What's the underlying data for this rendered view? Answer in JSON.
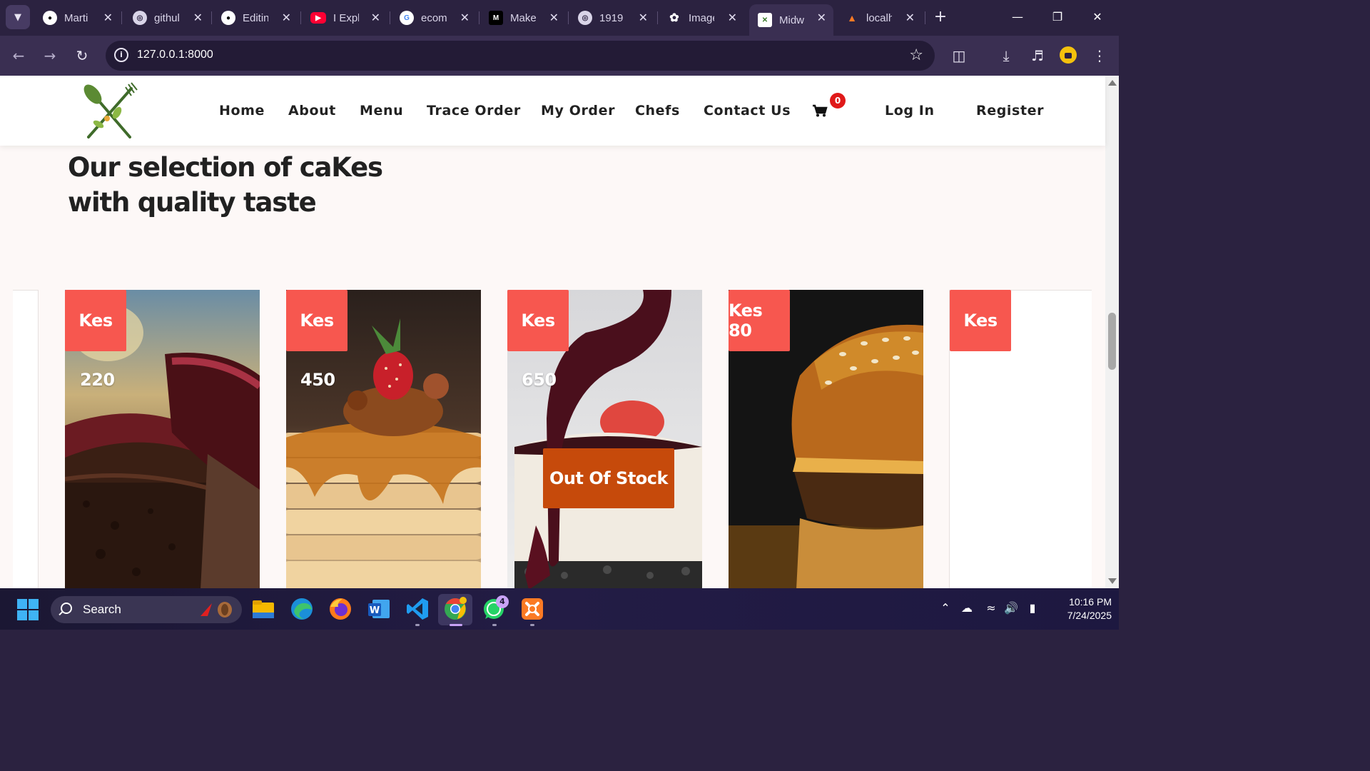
{
  "browser": {
    "tabs": [
      {
        "title": "Marti",
        "icon": "github-icon"
      },
      {
        "title": "githul",
        "icon": "globe-icon"
      },
      {
        "title": "Editin",
        "icon": "github-icon"
      },
      {
        "title": "I Expl",
        "icon": "youtube-icon"
      },
      {
        "title": "ecom",
        "icon": "google-icon"
      },
      {
        "title": "Make",
        "icon": "medium-icon",
        "favicon_text": "M"
      },
      {
        "title": "1919",
        "icon": "globe-icon"
      },
      {
        "title": "Image",
        "icon": "openai-icon"
      },
      {
        "title": "Midw",
        "icon": "site-icon",
        "active": true
      },
      {
        "title": "localh",
        "icon": "xampp-icon"
      }
    ],
    "url": "127.0.0.1:8000"
  },
  "site": {
    "nav": {
      "links": [
        "Home",
        "About",
        "Menu",
        "Trace Order",
        "My Order",
        "Chefs",
        "Contact Us"
      ],
      "cart_count": "0",
      "login": "Log In",
      "register": "Register"
    },
    "section_title_line1": "Our selection of caKes",
    "section_title_line2": "with quality taste",
    "products": [
      {
        "price_tag": "Kes",
        "price_value": "220",
        "image": "chocolate cake"
      },
      {
        "price_tag": "Kes",
        "price_value": "450",
        "image": "pancakes"
      },
      {
        "price_tag": "Kes",
        "price_value": "650",
        "image": "cheesecake",
        "badge": "Out Of Stock"
      },
      {
        "price_tag": "Kes 80",
        "price_value": "",
        "image": "burger"
      },
      {
        "price_tag": "Kes",
        "price_value": "",
        "image": "blank"
      }
    ]
  },
  "taskbar": {
    "search_label": "Search",
    "whatsapp_badge": "4",
    "time": "10:16 PM",
    "date": "7/24/2025"
  },
  "colors": {
    "price_tag": "#f7574f",
    "out_of_stock": "#c64a0b",
    "cart_badge": "#e01919",
    "browser_frame": "#2b2240"
  }
}
